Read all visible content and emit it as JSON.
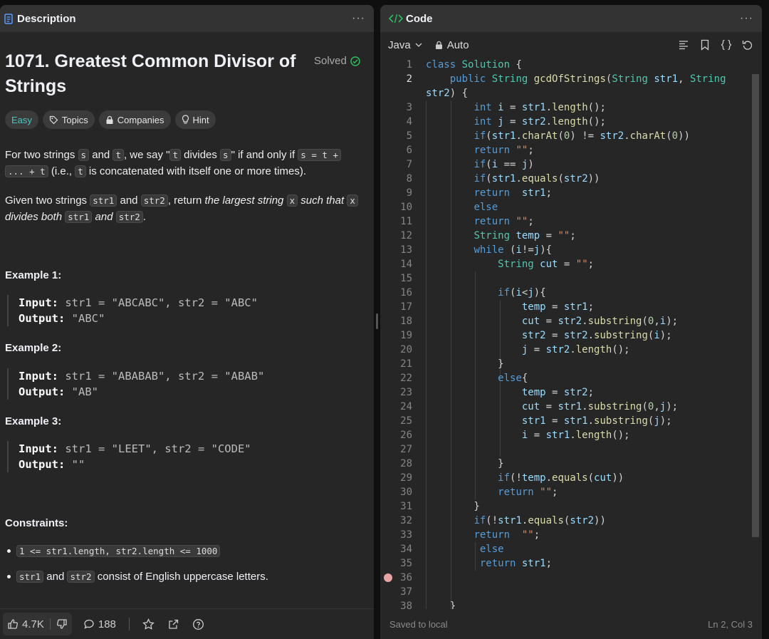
{
  "left_panel": {
    "title": "Description",
    "problem_title": "1071. Greatest Common Divisor of Strings",
    "status": "Solved",
    "tags": {
      "difficulty": "Easy",
      "topics": "Topics",
      "companies": "Companies",
      "hint": "Hint"
    },
    "statement": {
      "p1": [
        "For two strings ",
        "s",
        " and ",
        "t",
        ", we say \"",
        "t",
        " divides ",
        "s",
        "\" if and only if ",
        "s = t +",
        "... + t",
        " (i.e., ",
        "t",
        " is concatenated with itself one or more times)."
      ],
      "p2": [
        "Given two strings ",
        "str1",
        " and ",
        "str2",
        ", return ",
        "the largest string ",
        "x",
        " such that ",
        "x",
        "divides both ",
        "str1",
        " and ",
        "str2",
        "."
      ]
    },
    "examples": [
      {
        "heading": "Example 1:",
        "input_label": "Input:",
        "input": " str1 = \"ABCABC\", str2 = \"ABC\"",
        "output_label": "Output:",
        "output": " \"ABC\""
      },
      {
        "heading": "Example 2:",
        "input_label": "Input:",
        "input": " str1 = \"ABABAB\", str2 = \"ABAB\"",
        "output_label": "Output:",
        "output": " \"AB\""
      },
      {
        "heading": "Example 3:",
        "input_label": "Input:",
        "input": " str1 = \"LEET\", str2 = \"CODE\"",
        "output_label": "Output:",
        "output": " \"\""
      }
    ],
    "constraints_heading": "Constraints:",
    "constraints": {
      "c1": "1 <= str1.length, str2.length <= 1000",
      "c2_code1": "str1",
      "c2_mid": " and ",
      "c2_code2": "str2",
      "c2_rest": " consist of English uppercase letters."
    },
    "footer": {
      "likes": "4.7K",
      "comments": "188"
    }
  },
  "right_panel": {
    "title": "Code",
    "language": "Java",
    "mode": "Auto",
    "status_left": "Saved to local",
    "status_right": "Ln 2, Col 3",
    "code_lines": [
      "1",
      "2",
      "",
      "3",
      "4",
      "5",
      "6",
      "7",
      "8",
      "9",
      "10",
      "11",
      "12",
      "13",
      "14",
      "15",
      "16",
      "17",
      "18",
      "19",
      "20",
      "21",
      "22",
      "23",
      "24",
      "25",
      "26",
      "27",
      "28",
      "29",
      "30",
      "31",
      "32",
      "33",
      "34",
      "35",
      "36",
      "37",
      "38"
    ]
  },
  "colors": {
    "accent_green": "#2cbb5d",
    "easy": "#46c6c2",
    "breakpoint": "#e8a3a3"
  }
}
